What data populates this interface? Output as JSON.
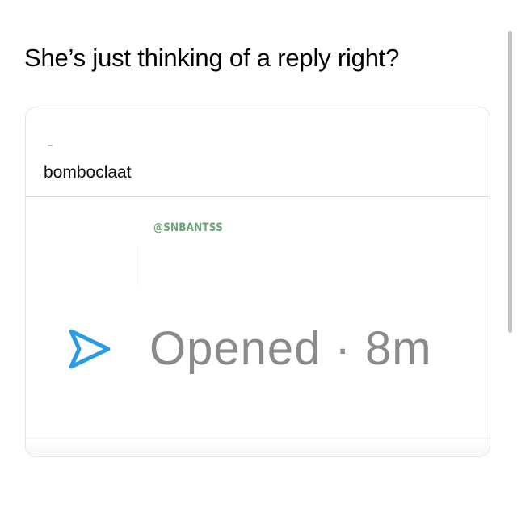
{
  "post": {
    "caption": "She’s just thinking of a reply right?"
  },
  "card": {
    "title": "bomboclaat",
    "watermark": "@SNBANTSS",
    "status": {
      "icon": "snapchat-opened-arrow-icon",
      "icon_color": "#2a9be0",
      "label": "Opened · 8m"
    }
  },
  "colors": {
    "caption": "#000000",
    "watermark": "#6aa67a",
    "status_text": "#8a8a8a",
    "card_border": "#e3e3e3"
  }
}
